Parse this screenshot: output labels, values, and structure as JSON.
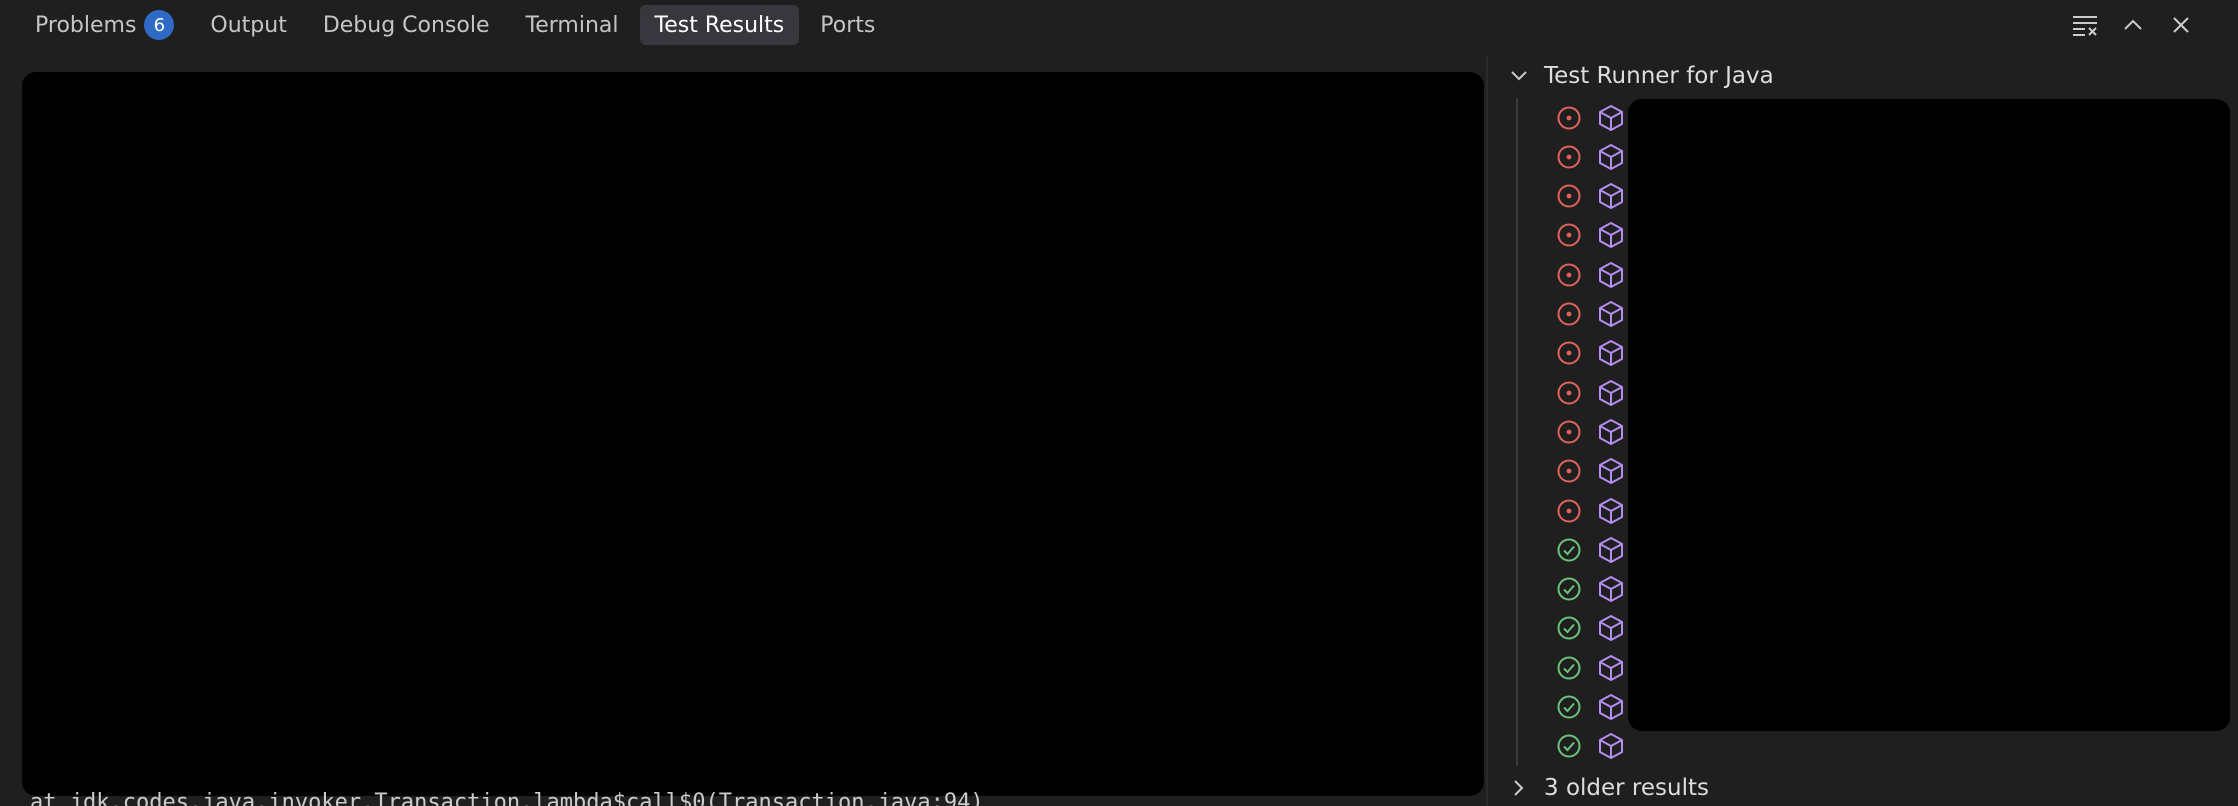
{
  "tabs": [
    {
      "label": "Problems",
      "badge": "6",
      "active": false
    },
    {
      "label": "Output",
      "active": false
    },
    {
      "label": "Debug Console",
      "active": false
    },
    {
      "label": "Terminal",
      "active": false
    },
    {
      "label": "Test Results",
      "active": true
    },
    {
      "label": "Ports",
      "active": false
    }
  ],
  "actions": [
    "clear-results-icon",
    "maximize-panel-icon",
    "close-panel-icon"
  ],
  "output": {
    "peek_text": "at jdk.codes.java.invoker.Transaction.lambda$call$0(Transaction.java:94)"
  },
  "tree": {
    "header": "Test Runner for Java",
    "older_results": "3 older results",
    "rows": [
      {
        "status": "failed"
      },
      {
        "status": "failed"
      },
      {
        "status": "failed"
      },
      {
        "status": "failed"
      },
      {
        "status": "failed"
      },
      {
        "status": "failed"
      },
      {
        "status": "failed"
      },
      {
        "status": "failed"
      },
      {
        "status": "failed"
      },
      {
        "status": "failed"
      },
      {
        "status": "failed"
      },
      {
        "status": "passed"
      },
      {
        "status": "passed"
      },
      {
        "status": "passed"
      },
      {
        "status": "passed"
      },
      {
        "status": "passed"
      },
      {
        "status": "passed"
      }
    ]
  },
  "colors": {
    "failed": "#e0635b",
    "passed": "#6cc27a",
    "package": "#b48ef0",
    "badge": "#2f6bc4"
  }
}
